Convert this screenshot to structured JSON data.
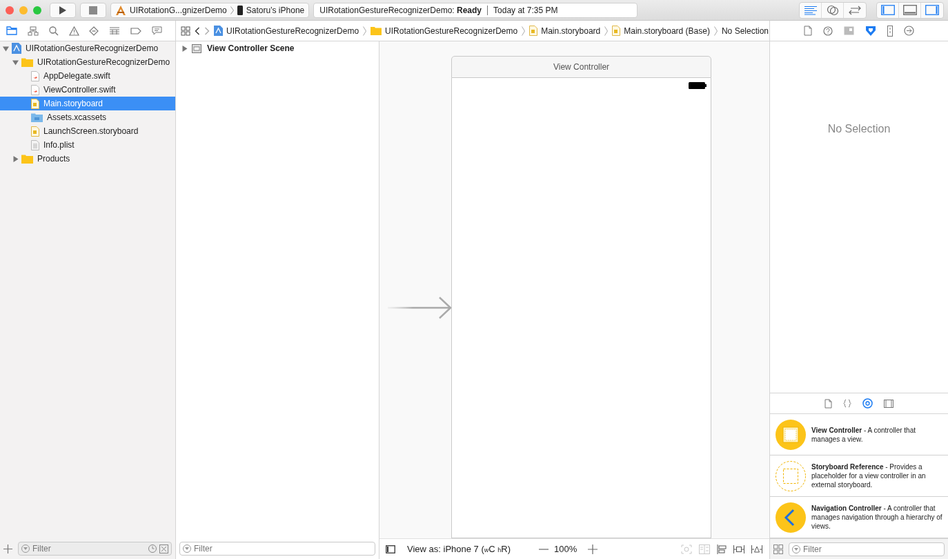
{
  "toolbar": {
    "window_controls": [
      {
        "kind": "close"
      },
      {
        "kind": "minimize"
      },
      {
        "kind": "zoom"
      }
    ],
    "scheme": "UIRotationG...gnizerDemo",
    "device": "Satoru’s iPhone",
    "status": "UIRotationGestureRecognizerDemo: **Ready**",
    "time": "Today at 7:35 PM",
    "editor_modes": [
      {
        "selected": true
      },
      {
        "selected": false
      },
      {
        "selected": false
      }
    ],
    "panels": [
      {
        "on": true
      },
      {
        "on": false
      },
      {
        "on": true
      }
    ]
  },
  "navigator_tabs": [
    {
      "selected": true
    },
    {
      "selected": false
    },
    {
      "selected": false
    },
    {
      "selected": false
    },
    {
      "selected": false
    },
    {
      "selected": false
    },
    {
      "selected": false
    },
    {
      "selected": false
    }
  ],
  "jump_bar": [
    {
      "label": "UIRotationGestureRecognizerDemo",
      "kind": "project"
    },
    {
      "label": "UIRotationGestureRecognizerDemo",
      "kind": "folder"
    },
    {
      "label": "Main.storyboard",
      "kind": "storyboard"
    },
    {
      "label": "Main.storyboard (Base)",
      "kind": "storyboard"
    },
    {
      "label": "No Selection",
      "kind": "none"
    }
  ],
  "inspector_tabs": [
    {
      "selected": false
    },
    {
      "selected": false
    },
    {
      "selected": false
    },
    {
      "selected": true
    },
    {
      "selected": false
    },
    {
      "selected": false
    }
  ],
  "navigator": {
    "tree": [
      {
        "label": "UIRotationGestureRecognizerDemo",
        "kind": "project",
        "expanded": true,
        "selected": false,
        "children": [
          {
            "label": "UIRotationGestureRecognizerDemo",
            "kind": "folder",
            "expanded": true,
            "selected": false,
            "children": [
              {
                "label": "AppDelegate.swift",
                "kind": "swift",
                "selected": false
              },
              {
                "label": "ViewController.swift",
                "kind": "swift",
                "selected": false
              },
              {
                "label": "Main.storyboard",
                "kind": "storyboard",
                "selected": true
              },
              {
                "label": "Assets.xcassets",
                "kind": "assets",
                "selected": false
              },
              {
                "label": "LaunchScreen.storyboard",
                "kind": "storyboard",
                "selected": false
              },
              {
                "label": "Info.plist",
                "kind": "plist",
                "selected": false
              }
            ]
          },
          {
            "label": "Products",
            "kind": "folder",
            "expanded": false,
            "selected": false
          }
        ]
      }
    ],
    "filter": {
      "placeholder": "Filter"
    }
  },
  "outline": {
    "items": [
      {
        "label": "View Controller Scene",
        "expanded": false
      }
    ],
    "filter": {
      "placeholder": "Filter"
    }
  },
  "canvas": {
    "scene_title": "View Controller",
    "view_as": "View as: iPhone 7 ($_{w}$C $_{h}$R)",
    "zoom": "100%",
    "tools": [
      {
        "disabled": true
      },
      {
        "disabled": true
      },
      {
        "disabled": false
      },
      {
        "disabled": false
      },
      {
        "disabled": false
      }
    ]
  },
  "inspector": {
    "empty_text": "No Selection"
  },
  "library_tabs": [
    {
      "selected": false
    },
    {
      "selected": false
    },
    {
      "selected": true
    },
    {
      "selected": false
    }
  ],
  "library": {
    "items": [
      {
        "kind": "view-controller",
        "text": "**View Controller** - A controller that manages a view."
      },
      {
        "kind": "storyboard-reference",
        "text": "**Storyboard Reference** - Provides a placeholder for a view controller in an external storyboard."
      },
      {
        "kind": "navigation-controller",
        "text": "**Navigation Controller** - A controller that manages navigation through a hierarchy of views."
      }
    ],
    "filter": {
      "placeholder": "Filter"
    }
  }
}
